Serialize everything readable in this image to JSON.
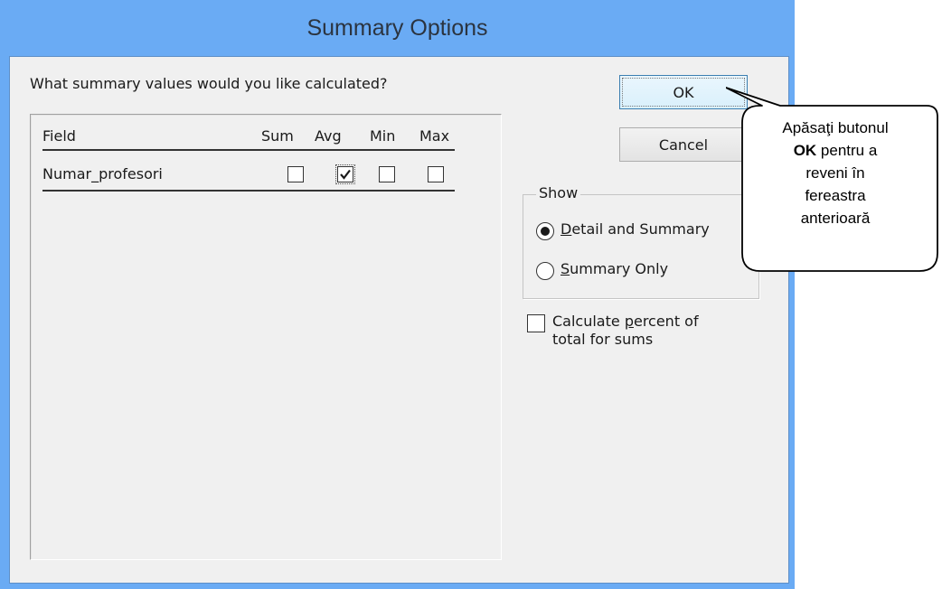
{
  "dialog": {
    "title": "Summary Options",
    "prompt": "What summary values would you like calculated?",
    "columns": {
      "field": "Field",
      "sum": "Sum",
      "avg": "Avg",
      "min": "Min",
      "max": "Max"
    },
    "rows": [
      {
        "field": "Numar_profesori",
        "sum": false,
        "avg": true,
        "min": false,
        "max": false
      }
    ],
    "buttons": {
      "ok": "OK",
      "cancel": "Cancel"
    },
    "show_group": {
      "legend": "Show",
      "options": [
        {
          "accel": "D",
          "rest": "etail and Summary",
          "selected": true
        },
        {
          "accel": "S",
          "rest": "ummary Only",
          "selected": false
        }
      ]
    },
    "percent_checkbox": {
      "line1_pre": "Calculate ",
      "line1_accel": "p",
      "line1_post": "ercent of",
      "line2": "total for sums",
      "checked": false
    }
  },
  "callout": {
    "line1": "Apăsaţi butonul",
    "line2_bold": "OK",
    "line2_rest": " pentru a",
    "line3": "reveni în",
    "line4": "fereastra",
    "line5": "anterioară"
  },
  "colors": {
    "titlebar": "#6aabf4",
    "client": "#f0f0f0"
  }
}
